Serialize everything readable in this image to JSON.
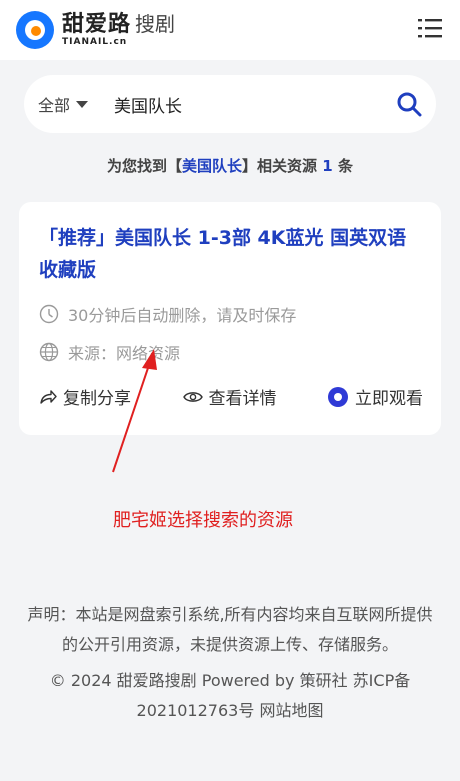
{
  "header": {
    "brand_main": "甜爱路",
    "brand_suffix": "搜剧",
    "brand_sub": "TIANAIL.cn",
    "logo_color": "#1677ff"
  },
  "search": {
    "scope": "全部",
    "query": "美国队长",
    "icon": "search-icon"
  },
  "result_summary": {
    "prefix": "为您找到【",
    "keyword": "美国队长",
    "middle": "】相关资源",
    "count": "1",
    "suffix": "条"
  },
  "results": [
    {
      "title": "「推荐」美国队长 1-3部 4K蓝光 国英双语收藏版",
      "notice": "30分钟后自动删除，请及时保存",
      "source": "来源：网络资源",
      "actions": {
        "share": "复制分享",
        "details": "查看详情",
        "watch": "立即观看"
      }
    }
  ],
  "annotation": {
    "text": "肥宅姬选择搜索的资源",
    "color": "#e02020"
  },
  "footer": {
    "disclaimer": "声明：本站是网盘索引系统,所有内容均来自互联网所提供的公开引用资源，未提供资源上传、存储服务。",
    "copyright": "© 2024 甜爱路搜剧 Powered by 策研社",
    "icp": "苏ICP备2021012763号",
    "sitemap": "网站地图"
  },
  "colors": {
    "accent": "#1f3fbf",
    "watch": "#2f3ad6",
    "background": "#f3f4f6"
  }
}
